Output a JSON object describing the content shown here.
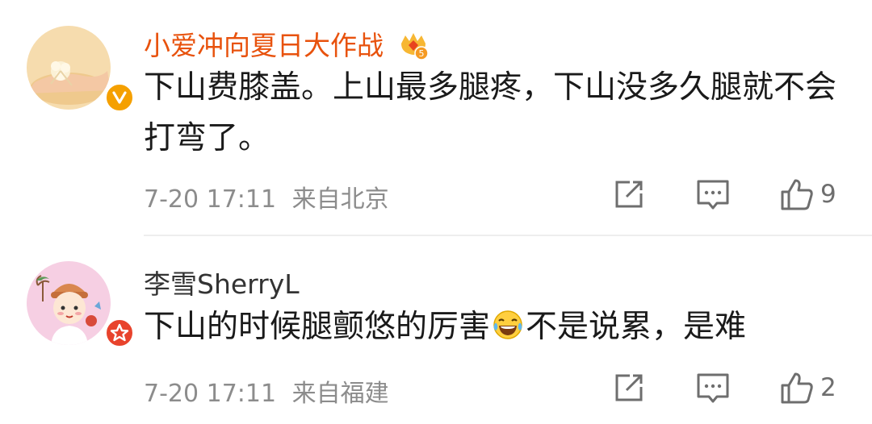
{
  "comments": [
    {
      "username": "小爱冲向夏日大作战",
      "username_color": "#e8520d",
      "badge_level": "5",
      "text": "下山费膝盖。上山最多腿疼，下山没多久腿就不会打弯了。",
      "time": "7-20 17:11",
      "location": "来自北京",
      "likes": "9",
      "verify_badge_color": "#f5a000",
      "verify_badge_icon": "v-verified-icon"
    },
    {
      "username": "李雪SherryL",
      "username_color": "#333333",
      "text_before": "下山的时候腿颤悠的厉害",
      "emoji": "laugh-cry-emoji",
      "text_after": "不是说累，是难",
      "time": "7-20 17:11",
      "location": "来自福建",
      "likes": "2",
      "verify_badge_color": "#e8432c",
      "verify_badge_icon": "star-verified-icon"
    }
  ]
}
